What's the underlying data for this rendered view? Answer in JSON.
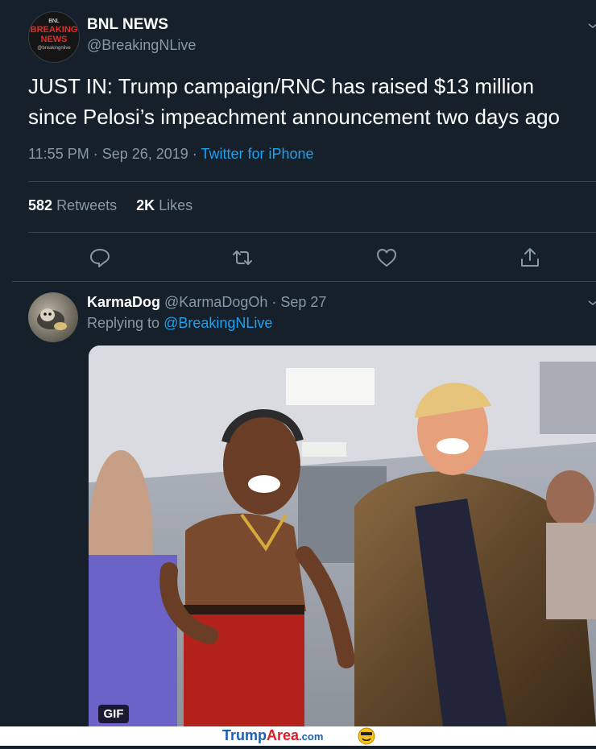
{
  "tweet": {
    "avatar_text": [
      "BNL",
      "BREAKING",
      "NEWS",
      "@breakingnlive"
    ],
    "name": "BNL NEWS",
    "handle": "@BreakingNLive",
    "text_line1": "JUST IN: Trump campaign/RNC has raised $13 million",
    "text_line2": "since Pelosi’s impeachment announcement two days ago",
    "time": "11:55 PM · Sep 26, 2019 · ",
    "source": "Twitter for iPhone",
    "retweets_count": "582",
    "retweets_label": "Retweets",
    "likes_count": "2K",
    "likes_label": "Likes",
    "actions": [
      "reply-icon",
      "retweet-icon",
      "like-icon",
      "share-icon"
    ]
  },
  "reply": {
    "name": "KarmaDog",
    "handle_date": " @KarmaDogOh · Sep 27",
    "replying_prefix": "Replying to ",
    "replying_to": "@BreakingNLive",
    "media_badge": "GIF"
  },
  "footer": {
    "brand_part1": "Trump",
    "brand_part2": "Area",
    "brand_part3": ".com"
  },
  "colors": {
    "background": "#15202b",
    "secondary_text": "#8899a6",
    "link": "#1da1f2",
    "divider": "#38444d",
    "brand_blue": "#1c5fb6",
    "brand_red": "#e01b24"
  }
}
